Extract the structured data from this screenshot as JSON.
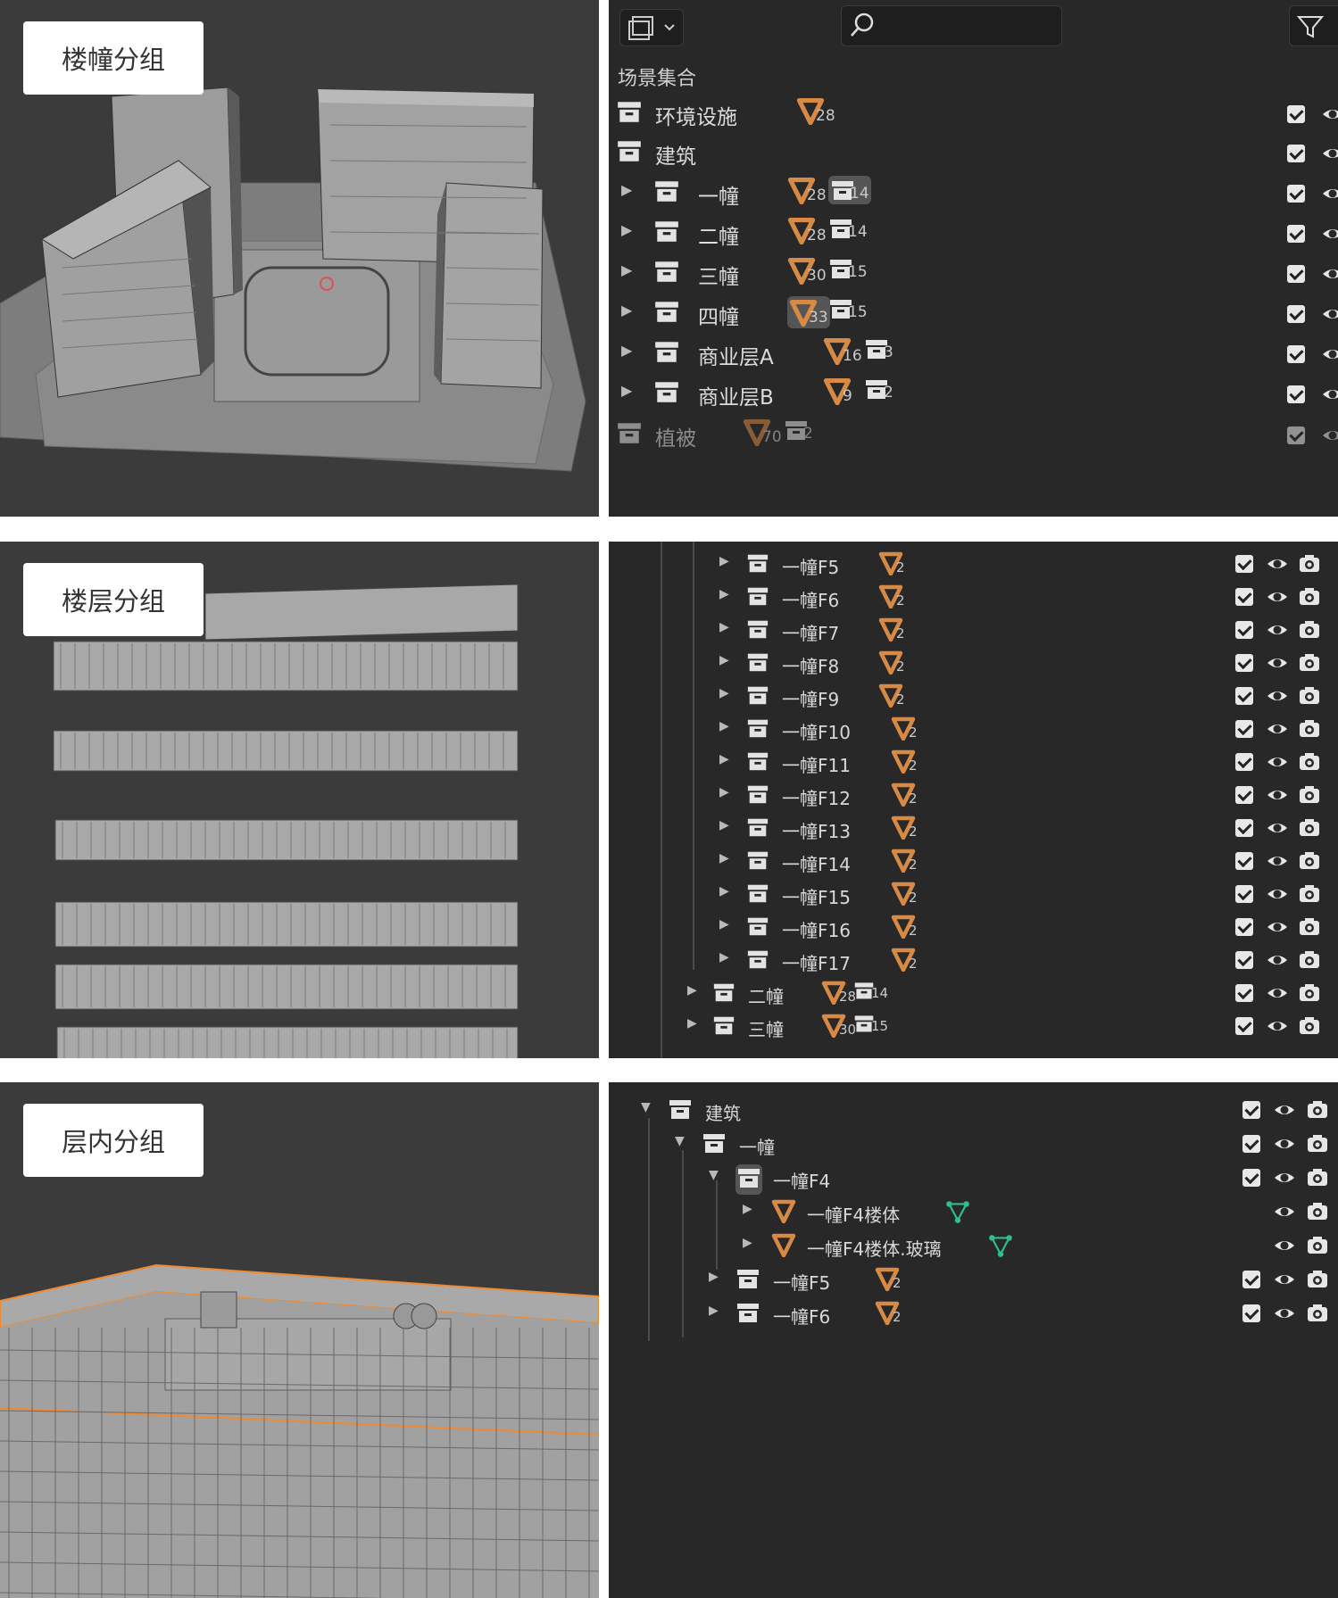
{
  "panel1": {
    "viewport_label": "楼幢分组",
    "outliner": {
      "header": {
        "search_placeholder": ""
      },
      "scene_label": "场景集合",
      "rows": [
        {
          "name": "环境设施",
          "mesh": "28",
          "coll": ""
        },
        {
          "name": "建筑",
          "mesh": "",
          "coll": ""
        },
        {
          "name": "一幢",
          "mesh": "28",
          "coll": "14"
        },
        {
          "name": "二幢",
          "mesh": "28",
          "coll": "14"
        },
        {
          "name": "三幢",
          "mesh": "30",
          "coll": "15"
        },
        {
          "name": "四幢",
          "mesh": "33",
          "coll": "15"
        },
        {
          "name": "商业层A",
          "mesh": "16",
          "coll": "3"
        },
        {
          "name": "商业层B",
          "mesh": "9",
          "coll": "2"
        },
        {
          "name": "植被",
          "mesh": "70",
          "coll": "2"
        }
      ]
    }
  },
  "panel2": {
    "viewport_label": "楼层分组",
    "outliner": {
      "rows": [
        {
          "name": "一幢F5",
          "mesh": "2"
        },
        {
          "name": "一幢F6",
          "mesh": "2"
        },
        {
          "name": "一幢F7",
          "mesh": "2"
        },
        {
          "name": "一幢F8",
          "mesh": "2"
        },
        {
          "name": "一幢F9",
          "mesh": "2"
        },
        {
          "name": "一幢F10",
          "mesh": "2"
        },
        {
          "name": "一幢F11",
          "mesh": "2"
        },
        {
          "name": "一幢F12",
          "mesh": "2"
        },
        {
          "name": "一幢F13",
          "mesh": "2"
        },
        {
          "name": "一幢F14",
          "mesh": "2"
        },
        {
          "name": "一幢F15",
          "mesh": "2"
        },
        {
          "name": "一幢F16",
          "mesh": "2"
        },
        {
          "name": "一幢F17",
          "mesh": "2"
        },
        {
          "name": "二幢",
          "mesh": "28",
          "coll": "14"
        },
        {
          "name": "三幢",
          "mesh": "30",
          "coll": "15"
        }
      ]
    }
  },
  "panel3": {
    "viewport_label": "层内分组",
    "outliner": {
      "rows": [
        {
          "name": "建筑"
        },
        {
          "name": "一幢"
        },
        {
          "name": "一幢F4"
        },
        {
          "name": "一幢F4楼体"
        },
        {
          "name": "一幢F4楼体.玻璃"
        },
        {
          "name": "一幢F5",
          "mesh": "2"
        },
        {
          "name": "一幢F6",
          "mesh": "2"
        }
      ]
    }
  },
  "colors": {
    "mesh_orange": "#d68a45",
    "vertex_green": "#2fbf8a",
    "panel_bg": "#282828",
    "viewport_bg": "#3b3b3b"
  }
}
